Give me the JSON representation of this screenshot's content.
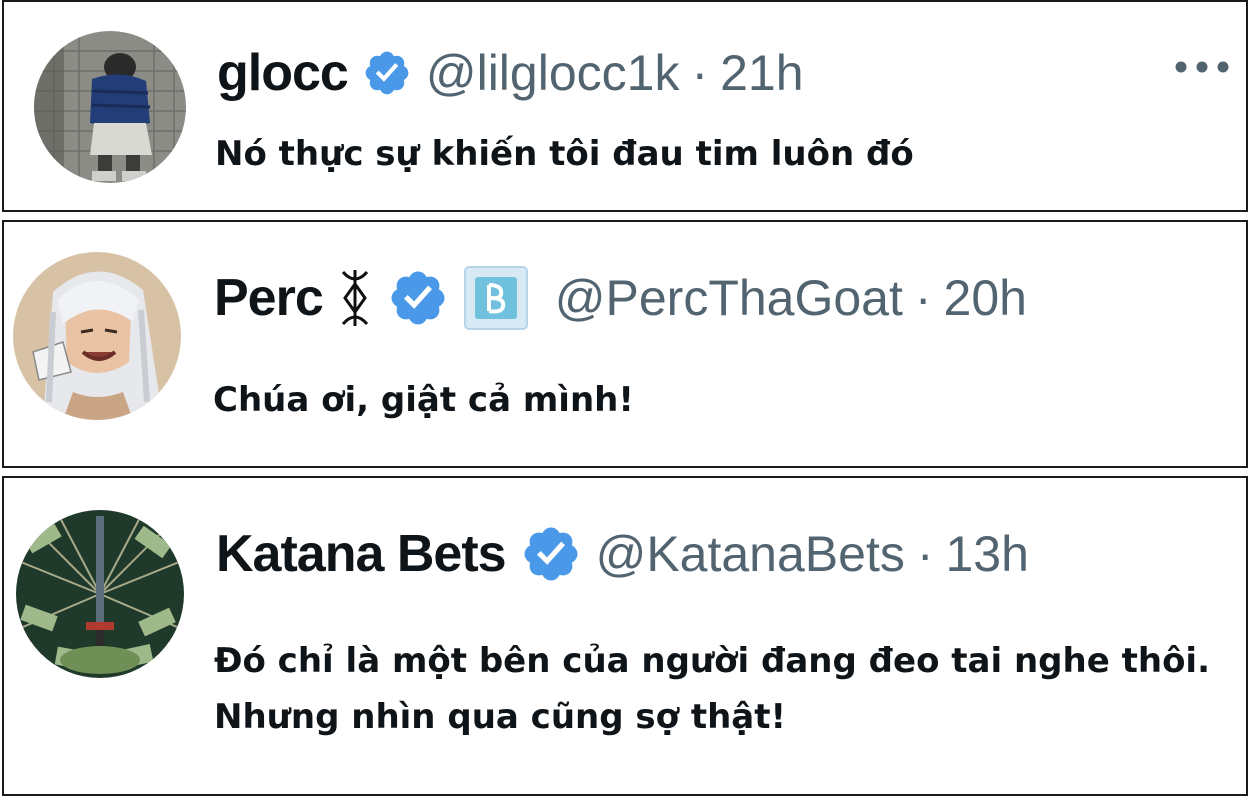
{
  "tweets": [
    {
      "name": "glocc",
      "verified_icon": "verified-badge-icon",
      "handle": "@lilglocc1k",
      "separator": "·",
      "time": "21h",
      "more_icon": "more-options-icon",
      "text": "Nó thực sự khiến tôi đau tim luôn đó",
      "avatar": "avatar-person-in-puffer-jacket"
    },
    {
      "name": "Perc",
      "symbol_icon": "brand-of-sacrifice-icon",
      "verified_icon": "verified-badge-icon",
      "affiliate_icon": "affiliate-badge-icon",
      "handle": "@PercThaGoat",
      "separator": "·",
      "time": "20h",
      "text": "Chúa ơi, giật cả mình!",
      "avatar": "avatar-anime-white-haired-character"
    },
    {
      "name": "Katana Bets",
      "verified_icon": "verified-badge-icon",
      "handle": "@KatanaBets",
      "separator": "·",
      "time": "13h",
      "text_lines": [
        "Đó chỉ là một bên của người đang đeo tai nghe thôi.",
        "Nhưng nhìn qua cũng sợ thật!"
      ],
      "avatar": "avatar-katana-and-money"
    }
  ],
  "colors": {
    "name": "#0f1419",
    "handle": "#536471",
    "verified": "#4a99e9",
    "border": "#1a1a1a"
  }
}
